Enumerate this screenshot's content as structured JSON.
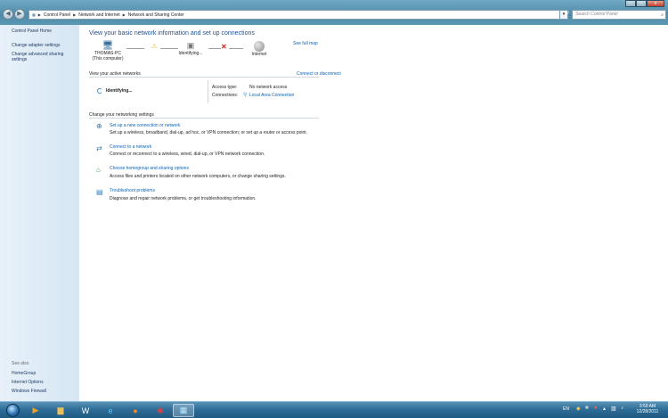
{
  "window": {
    "controls": {
      "minimize": "–",
      "maximize": "□",
      "close": "x"
    },
    "nav": {
      "back": "◀",
      "forward": "▶"
    },
    "address": {
      "crumbs": [
        "Control Panel",
        "Network and Internet",
        "Network and Sharing Center"
      ],
      "separator": "▶",
      "refresh": "↻",
      "dropdown": "▾"
    },
    "search": {
      "placeholder": "Search Control Panel",
      "icon": "search-icon"
    },
    "help": "?"
  },
  "left_pane": {
    "home": "Control Panel Home",
    "links": [
      "Change adapter settings",
      "Change advanced sharing settings"
    ],
    "see_also_heading": "See also",
    "see_also": [
      "HomeGroup",
      "Internet Options",
      "Windows Firewall"
    ]
  },
  "main": {
    "title": "View your basic network information and set up connections",
    "see_full_map": "See full map",
    "map": {
      "computer_name": "THOMAS-PC",
      "computer_sub": "(This computer)",
      "middle": "Identifying...",
      "internet": "Internet"
    },
    "active_networks": {
      "heading": "View your active networks",
      "action": "Connect or disconnect",
      "network_name": "Identifying...",
      "access_type_label": "Access type:",
      "access_type_value": "No network access",
      "connections_label": "Connections:",
      "connections_value": "Local Area Connection"
    },
    "settings": {
      "heading": "Change your networking settings",
      "tasks": [
        {
          "title": "Set up a new connection or network",
          "desc": "Set up a wireless, broadband, dial-up, ad hoc, or VPN connection; or set up a router or access point.",
          "icon": "new-connection-icon"
        },
        {
          "title": "Connect to a network",
          "desc": "Connect or reconnect to a wireless, wired, dial-up, or VPN network connection.",
          "icon": "connect-network-icon"
        },
        {
          "title": "Choose homegroup and sharing options",
          "desc": "Access files and printers located on other network computers, or change sharing settings.",
          "icon": "homegroup-icon"
        },
        {
          "title": "Troubleshoot problems",
          "desc": "Diagnose and repair network problems, or get troubleshooting information.",
          "icon": "troubleshoot-icon"
        }
      ]
    }
  },
  "taskbar": {
    "items": [
      "start-orb-icon",
      "media-player-icon",
      "explorer-folder-icon",
      "word-icon",
      "internet-explorer-icon",
      "firefox-icon",
      "chrome-icon",
      "network-center-icon"
    ],
    "language": "EN",
    "time": "3:59 AM",
    "date": "12/28/2011"
  }
}
